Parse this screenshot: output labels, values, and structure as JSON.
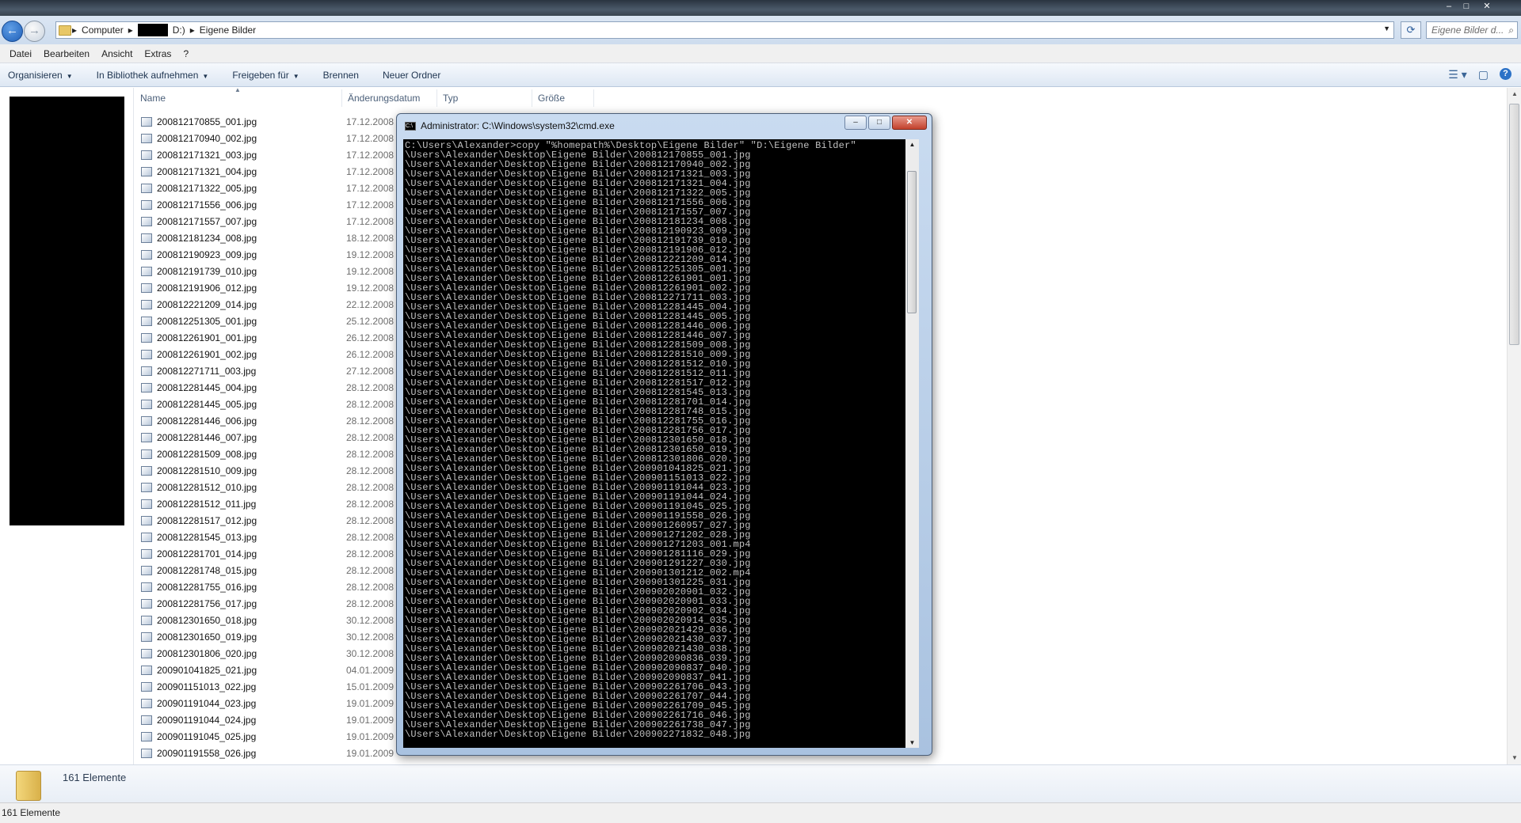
{
  "explorer": {
    "breadcrumb": [
      "Computer",
      "D:)",
      "Eigene Bilder"
    ],
    "search_placeholder": "Eigene Bilder d...",
    "menu": [
      "Datei",
      "Bearbeiten",
      "Ansicht",
      "Extras",
      "?"
    ],
    "commands": [
      "Organisieren",
      "In Bibliothek aufnehmen",
      "Freigeben für",
      "Brennen",
      "Neuer Ordner"
    ],
    "columns": {
      "name": "Name",
      "date": "Änderungsdatum",
      "type": "Typ",
      "size": "Größe"
    },
    "files": [
      {
        "name": "200812170855_001.jpg",
        "date": "17.12.2008"
      },
      {
        "name": "200812170940_002.jpg",
        "date": "17.12.2008"
      },
      {
        "name": "200812171321_003.jpg",
        "date": "17.12.2008"
      },
      {
        "name": "200812171321_004.jpg",
        "date": "17.12.2008"
      },
      {
        "name": "200812171322_005.jpg",
        "date": "17.12.2008"
      },
      {
        "name": "200812171556_006.jpg",
        "date": "17.12.2008"
      },
      {
        "name": "200812171557_007.jpg",
        "date": "17.12.2008"
      },
      {
        "name": "200812181234_008.jpg",
        "date": "18.12.2008"
      },
      {
        "name": "200812190923_009.jpg",
        "date": "19.12.2008"
      },
      {
        "name": "200812191739_010.jpg",
        "date": "19.12.2008"
      },
      {
        "name": "200812191906_012.jpg",
        "date": "19.12.2008"
      },
      {
        "name": "200812221209_014.jpg",
        "date": "22.12.2008"
      },
      {
        "name": "200812251305_001.jpg",
        "date": "25.12.2008"
      },
      {
        "name": "200812261901_001.jpg",
        "date": "26.12.2008"
      },
      {
        "name": "200812261901_002.jpg",
        "date": "26.12.2008"
      },
      {
        "name": "200812271711_003.jpg",
        "date": "27.12.2008"
      },
      {
        "name": "200812281445_004.jpg",
        "date": "28.12.2008"
      },
      {
        "name": "200812281445_005.jpg",
        "date": "28.12.2008"
      },
      {
        "name": "200812281446_006.jpg",
        "date": "28.12.2008"
      },
      {
        "name": "200812281446_007.jpg",
        "date": "28.12.2008"
      },
      {
        "name": "200812281509_008.jpg",
        "date": "28.12.2008"
      },
      {
        "name": "200812281510_009.jpg",
        "date": "28.12.2008"
      },
      {
        "name": "200812281512_010.jpg",
        "date": "28.12.2008"
      },
      {
        "name": "200812281512_011.jpg",
        "date": "28.12.2008"
      },
      {
        "name": "200812281517_012.jpg",
        "date": "28.12.2008"
      },
      {
        "name": "200812281545_013.jpg",
        "date": "28.12.2008"
      },
      {
        "name": "200812281701_014.jpg",
        "date": "28.12.2008"
      },
      {
        "name": "200812281748_015.jpg",
        "date": "28.12.2008"
      },
      {
        "name": "200812281755_016.jpg",
        "date": "28.12.2008"
      },
      {
        "name": "200812281756_017.jpg",
        "date": "28.12.2008"
      },
      {
        "name": "200812301650_018.jpg",
        "date": "30.12.2008"
      },
      {
        "name": "200812301650_019.jpg",
        "date": "30.12.2008"
      },
      {
        "name": "200812301806_020.jpg",
        "date": "30.12.2008"
      },
      {
        "name": "200901041825_021.jpg",
        "date": "04.01.2009"
      },
      {
        "name": "200901151013_022.jpg",
        "date": "15.01.2009"
      },
      {
        "name": "200901191044_023.jpg",
        "date": "19.01.2009"
      },
      {
        "name": "200901191044_024.jpg",
        "date": "19.01.2009"
      },
      {
        "name": "200901191045_025.jpg",
        "date": "19.01.2009"
      },
      {
        "name": "200901191558_026.jpg",
        "date": "19.01.2009"
      }
    ],
    "details_count": "161 Elemente",
    "status": "161 Elemente"
  },
  "cmd": {
    "title": "Administrator: C:\\Windows\\system32\\cmd.exe",
    "command": "C:\\Users\\Alexander>copy \"%homepath%\\Desktop\\Eigene Bilder\" \"D:\\Eigene Bilder\"",
    "line_prefix": "\\Users\\Alexander\\Desktop\\Eigene Bilder\\",
    "output_files": [
      "200812170855_001.jpg",
      "200812170940_002.jpg",
      "200812171321_003.jpg",
      "200812171321_004.jpg",
      "200812171322_005.jpg",
      "200812171556_006.jpg",
      "200812171557_007.jpg",
      "200812181234_008.jpg",
      "200812190923_009.jpg",
      "200812191739_010.jpg",
      "200812191906_012.jpg",
      "200812221209_014.jpg",
      "200812251305_001.jpg",
      "200812261901_001.jpg",
      "200812261901_002.jpg",
      "200812271711_003.jpg",
      "200812281445_004.jpg",
      "200812281445_005.jpg",
      "200812281446_006.jpg",
      "200812281446_007.jpg",
      "200812281509_008.jpg",
      "200812281510_009.jpg",
      "200812281512_010.jpg",
      "200812281512_011.jpg",
      "200812281517_012.jpg",
      "200812281545_013.jpg",
      "200812281701_014.jpg",
      "200812281748_015.jpg",
      "200812281755_016.jpg",
      "200812281756_017.jpg",
      "200812301650_018.jpg",
      "200812301650_019.jpg",
      "200812301806_020.jpg",
      "200901041825_021.jpg",
      "200901151013_022.jpg",
      "200901191044_023.jpg",
      "200901191044_024.jpg",
      "200901191045_025.jpg",
      "200901191558_026.jpg",
      "200901260957_027.jpg",
      "200901271202_028.jpg",
      "200901271203_001.mp4",
      "200901281116_029.jpg",
      "200901291227_030.jpg",
      "200901301212_002.mp4",
      "200901301225_031.jpg",
      "200902020901_032.jpg",
      "200902020901_033.jpg",
      "200902020902_034.jpg",
      "200902020914_035.jpg",
      "200902021429_036.jpg",
      "200902021430_037.jpg",
      "200902021430_038.jpg",
      "200902090836_039.jpg",
      "200902090837_040.jpg",
      "200902090837_041.jpg",
      "200902261706_043.jpg",
      "200902261707_044.jpg",
      "200902261709_045.jpg",
      "200902261716_046.jpg",
      "200902261738_047.jpg",
      "200902271832_048.jpg"
    ]
  }
}
